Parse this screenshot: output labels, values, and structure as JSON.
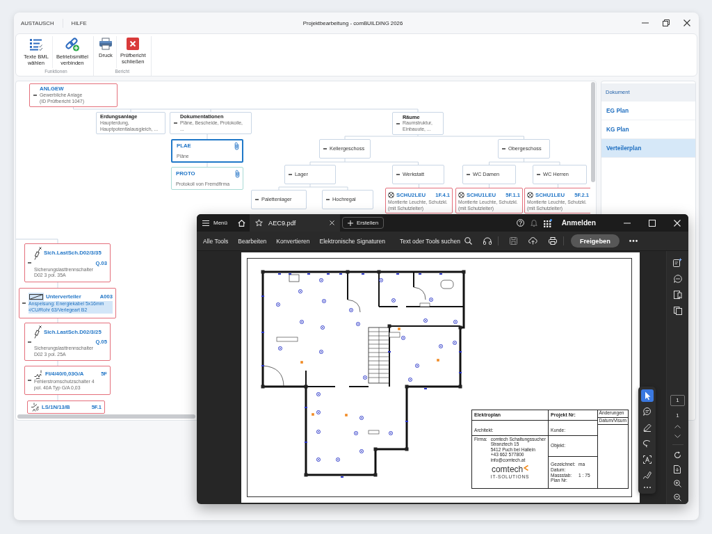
{
  "window": {
    "menu": [
      "AUSTAUSCH",
      "HILFE"
    ],
    "title": "Projektbearbeitung - comBUILDING 2026"
  },
  "ribbon": {
    "groups": [
      {
        "label": "Funktionen",
        "buttons": [
          "Texte BML\nwählen",
          "Betriebsmittel\nverbinden"
        ]
      },
      {
        "label": "Bericht",
        "buttons": [
          "Druck",
          "Prüfbericht\nschließen"
        ]
      }
    ]
  },
  "tree": {
    "root": {
      "kind": "plant",
      "code": "ANLGEW",
      "description": "Gewerbliche Anlage\n(ID Prüfbericht 1047)",
      "expanded": true,
      "flagged": true,
      "children": [
        {
          "kind": "group",
          "title": "Erdungsanlage",
          "description": "Haupterdung,\nHauptpotentialausgleich, ...",
          "flagged": false
        },
        {
          "kind": "group",
          "title": "Dokumentationen",
          "description": "Pläne, Bescheide, Protokolle,\n...",
          "expanded": true,
          "flagged": false,
          "children": [
            {
              "kind": "document",
              "code": "PLAE",
              "description": "Pläne",
              "selected": true
            },
            {
              "kind": "document",
              "code": "PROTO",
              "description": "Protokoll von Fremdfirma",
              "selected": false
            }
          ]
        },
        {
          "kind": "group",
          "title": "Räume",
          "description": "Raumstruktur,\nEinbauute, ...",
          "expanded": true,
          "flagged": false,
          "children": [
            {
              "kind": "room",
              "title": "Kellergeschoss",
              "expanded": true,
              "children": [
                {
                  "kind": "room",
                  "title": "Lager",
                  "expanded": true,
                  "children": [
                    {
                      "kind": "room",
                      "title": "Palettenlager",
                      "expanded": true
                    },
                    {
                      "kind": "room",
                      "title": "Hochregal",
                      "expanded": true
                    }
                  ]
                },
                {
                  "kind": "room",
                  "title": "Werkstatt",
                  "expanded": true,
                  "children": [
                    {
                      "kind": "device",
                      "code": "SCHU2LEU",
                      "designation": "1F.4.1",
                      "description": "Montierte Leuchte, Schutzkl.\n(mit Schutzleiter)",
                      "flagged": true
                    }
                  ]
                }
              ]
            },
            {
              "kind": "room",
              "title": "Obergeschoss",
              "expanded": true,
              "children": [
                {
                  "kind": "room",
                  "title": "WC Damen",
                  "expanded": true,
                  "children": [
                    {
                      "kind": "device",
                      "code": "SCHU1LEU",
                      "designation": "5F.1.1",
                      "description": "Montierte Leuchte, Schutzkl.\n(mit Schutzleiter)",
                      "flagged": true
                    }
                  ]
                },
                {
                  "kind": "room",
                  "title": "WC Herren",
                  "expanded": true,
                  "children": [
                    {
                      "kind": "device",
                      "code": "SCHU1LEU",
                      "designation": "5F.2.1",
                      "description": "Montierte Leuchte, Schutzkl.\n(mit Schutzleiter)",
                      "flagged": true
                    }
                  ]
                }
              ]
            }
          ]
        }
      ]
    },
    "lower_branch": [
      {
        "kind": "fuse",
        "code": "Sich.LastSch.D02/3/35",
        "designation": "Q.03",
        "description": "Sicherungslasttrennschalter\nD02 3 pol. 35A",
        "expanded": true,
        "flagged": true,
        "selected": false
      },
      {
        "kind": "distribution",
        "code": "Unterverteiler",
        "designation": "A003",
        "description": "Anspeisung: Energiekabel 5x16mm\n²/CU/Rohr 63/Verlegeart B2",
        "expanded": true,
        "flagged": true,
        "selected": true
      },
      {
        "kind": "fuse",
        "code": "Sich.LastSch.D02/3/25",
        "designation": "Q.05",
        "description": "Sicherungslasttrennschalter\nD02 3 pol. 25A",
        "expanded": true,
        "flagged": true,
        "selected": false
      },
      {
        "kind": "rcd",
        "code": "FI/4/40/0,03G/A",
        "designation": "5F",
        "description": "Fehlerstromschutzschalter 4\npol. 40A Typ G/A 0,03",
        "expanded": true,
        "flagged": true,
        "selected": false
      },
      {
        "kind": "breaker",
        "code": "LS/1N/13/B",
        "designation": "5F.1",
        "flagged": true,
        "selected": false
      }
    ]
  },
  "documents_panel": {
    "title": "Dokument",
    "items": [
      {
        "label": "EG Plan",
        "selected": false
      },
      {
        "label": "KG Plan",
        "selected": false
      },
      {
        "label": "Verteilerplan",
        "selected": true
      }
    ]
  },
  "pdf_viewer": {
    "menu_label": "Menü",
    "tab_title": "AEC9.pdf",
    "create_button": "Erstellen",
    "sign_in": "Anmelden",
    "toolbar": [
      "Alle Tools",
      "Bearbeiten",
      "Konvertieren",
      "Elektronische Signaturen"
    ],
    "search": "Text oder Tools suchen",
    "share_button": "Freigeben",
    "tools": [
      {
        "selected": true
      },
      {
        "selected": false
      },
      {
        "selected": false
      },
      {
        "selected": false
      },
      {
        "selected": false
      },
      {
        "selected": false
      }
    ],
    "page_field": "1",
    "page_count": "1",
    "title_block": {
      "plan_title": "Elektroplan",
      "project_label": "Projekt Nr:",
      "changes_label": "Änderungen",
      "changes_columns": "Datum/Visum",
      "architect_label": "Architekt:",
      "customer_label": "Kunde:",
      "company_label": "Firma:",
      "company_address": "comtech Schaltungssucher\nStranztech 15\n5412 Puch bei Hallein\n+43 662 577800\ninfo@comtech.at",
      "object_label": "Objekt:",
      "details": [
        {
          "label": "Gezeichnet:",
          "value": "ma"
        },
        {
          "label": "Datum:"
        },
        {
          "label": "Massstab:",
          "value": "1 : 75"
        },
        {
          "label": "Plan Nr:"
        }
      ],
      "logo_name": "comtech",
      "logo_tagline": "IT-SOLUTIONS"
    }
  }
}
